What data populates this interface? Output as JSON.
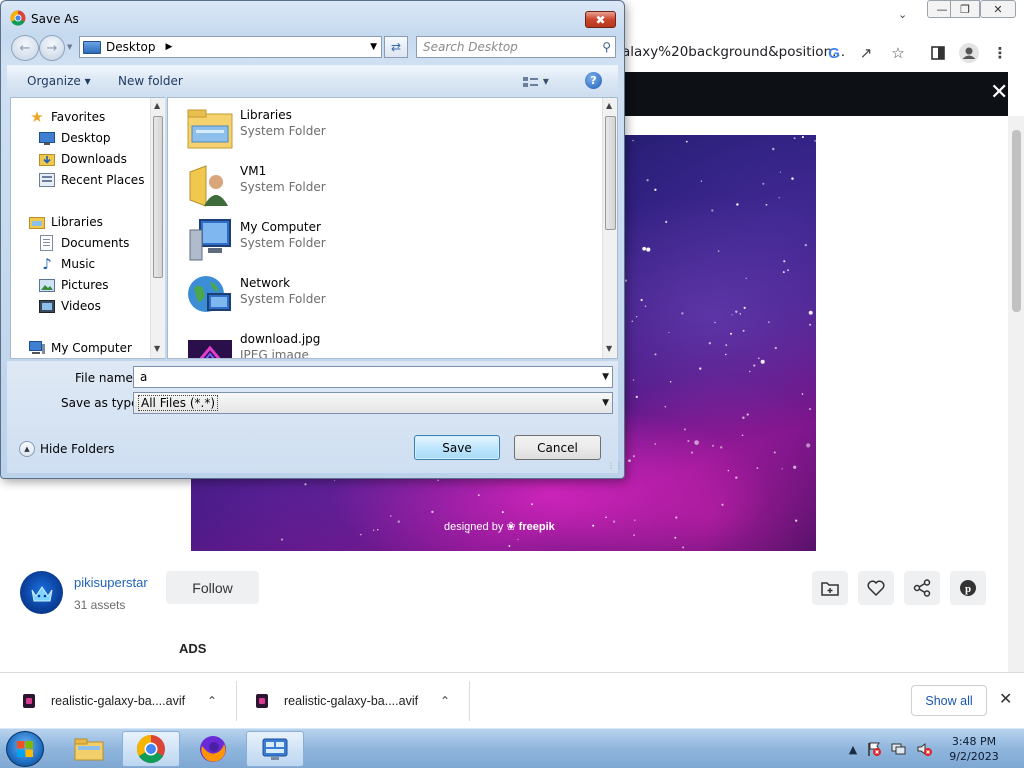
{
  "browser": {
    "url_tail": "alaxy%20background&position...",
    "page": {
      "author_name": "pikisuperstar",
      "author_assets": "31 assets",
      "follow_label": "Follow",
      "ads_label": "ADS",
      "image_credit_prefix": "designed by",
      "image_credit_brand": "freepik"
    },
    "downloads": {
      "items": [
        {
          "name": "realistic-galaxy-ba....avif"
        },
        {
          "name": "realistic-galaxy-ba....avif"
        }
      ],
      "show_all_label": "Show all"
    }
  },
  "dialog": {
    "title": "Save As",
    "address": "Desktop",
    "search_placeholder": "Search Desktop",
    "toolbar": {
      "organize_label": "Organize",
      "new_folder_label": "New folder"
    },
    "nav_pane": {
      "items": [
        {
          "label": "Favorites",
          "icon": "star-icon"
        },
        {
          "label": "Desktop",
          "icon": "desktop-icon"
        },
        {
          "label": "Downloads",
          "icon": "downloads-folder-icon"
        },
        {
          "label": "Recent Places",
          "icon": "recent-places-icon"
        },
        {
          "label": "Libraries",
          "icon": "libraries-icon"
        },
        {
          "label": "Documents",
          "icon": "documents-icon"
        },
        {
          "label": "Music",
          "icon": "music-icon"
        },
        {
          "label": "Pictures",
          "icon": "pictures-icon"
        },
        {
          "label": "Videos",
          "icon": "videos-icon"
        },
        {
          "label": "My Computer",
          "icon": "computer-icon"
        }
      ]
    },
    "files": [
      {
        "name": "Libraries",
        "type": "System Folder",
        "icon": "libraries-folder-icon"
      },
      {
        "name": "VM1",
        "type": "System Folder",
        "icon": "user-folder-icon"
      },
      {
        "name": "My Computer",
        "type": "System Folder",
        "icon": "computer-icon"
      },
      {
        "name": "Network",
        "type": "System Folder",
        "icon": "network-icon"
      },
      {
        "name": "download.jpg",
        "type": "JPEG image",
        "icon": "image-file-icon"
      }
    ],
    "form": {
      "file_name_label": "File name:",
      "file_name_value": "a",
      "save_type_label": "Save as type:",
      "save_type_value": "All Files (*.*)",
      "hide_folders_label": "Hide Folders",
      "save_label": "Save",
      "cancel_label": "Cancel"
    }
  },
  "taskbar": {
    "time": "3:48 PM",
    "date": "9/2/2023"
  }
}
